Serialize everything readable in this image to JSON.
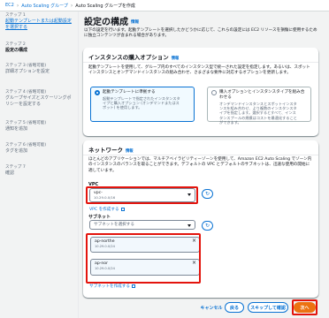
{
  "breadcrumb": {
    "items": [
      "EC2",
      "Auto Scaling グループ",
      "Auto Scaling グループを作成"
    ]
  },
  "sidebar": {
    "steps": [
      {
        "num": "ステップ 1",
        "title": "起動テンプレートまたは起動設定を選択する",
        "state": "link"
      },
      {
        "num": "ステップ 2",
        "title": "設定の構成",
        "state": "active"
      },
      {
        "num": "ステップ 3 (省略可能)",
        "title": "詳細オプションを設定",
        "state": "disabled"
      },
      {
        "num": "ステップ 4 (省略可能)",
        "title": "グループサイズとスケーリングポリシーを設定する",
        "state": "disabled"
      },
      {
        "num": "ステップ 5 (省略可能)",
        "title": "通知を追加",
        "state": "disabled"
      },
      {
        "num": "ステップ 6 (省略可能)",
        "title": "タグを追加",
        "state": "disabled"
      },
      {
        "num": "ステップ 7",
        "title": "確認",
        "state": "disabled"
      }
    ]
  },
  "header": {
    "title": "設定の構成",
    "info": "情報",
    "description": "以下の設定を行います。起動テンプレートを選択したかどうかに応じて、これらの設定には EC2 リソースを損傷に使用するために独立コンテンツが含まれる場合があります。"
  },
  "purchase_panel": {
    "title": "インスタンスの購入オプション",
    "info": "情報",
    "description": "起動テンプレートを使用して、グループ内のすべてのインスタンス型で統一された設定を指定します。あるいは、スポットインスタンスとオンデマンドインスタンスの組み合わせ、さまざまな要件に対応するオプションを更新します。",
    "options": [
      {
        "title": "起動テンプレートに準拠する",
        "desc": "起動テンプレートで指定されたインスタンスタイプと購入オプション (オンデマンドまたはスポット) を使用します。",
        "selected": true
      },
      {
        "title": "購入オプションとインスタンスタイプを組み合わせる",
        "desc": "オンデマンドインスタンスとスポットインスタンスを組み合わせ、より複数のインスタンスタイプを指定します。選択するとすべて、インスタンスプールの規模はコストを最適化することができます。",
        "selected": false
      }
    ]
  },
  "network_panel": {
    "title": "ネットワーク",
    "info": "情報",
    "description": "ほとんどのアプリケーションでは、マルチアベイラビリティーゾーンを使用して、Amazon EC2 Auto Scaling でゾーン内のインスタンスのバランスを取ることができます。デフォルトの VPC とデフォルトのサブネットは、迅速な使用の開始に適しています。",
    "vpc_label": "VPC",
    "vpc_value": "vpc-",
    "vpc_cidr": "10.29.0.0/16",
    "create_vpc_link": "VPC を作成する",
    "subnet_label": "サブネット",
    "subnet_placeholder": "サブネットを選択する",
    "subnets": [
      {
        "name": "ap-northe",
        "cidr": "10.29.0.0/24"
      },
      {
        "name": "ap-nor",
        "cidr": "10.29.0.0/24"
      }
    ],
    "create_subnet_link": "サブネットを作成する"
  },
  "footer": {
    "cancel": "キャンセル",
    "back": "戻る",
    "skip": "スキップして確認",
    "next": "次へ"
  },
  "colors": {
    "accent": "#0972d3",
    "primary_button": "#ec7211",
    "highlight": "#e3140d"
  }
}
